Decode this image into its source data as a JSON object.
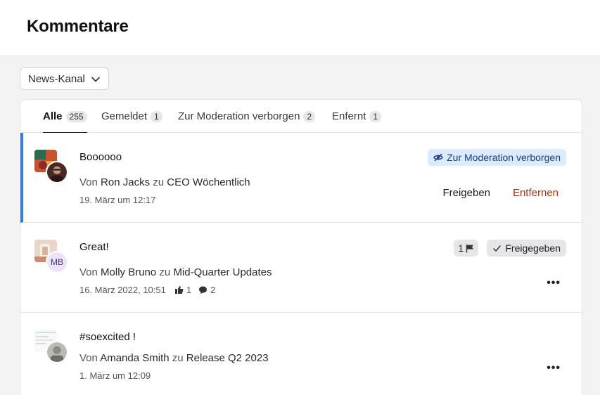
{
  "page": {
    "title": "Kommentare"
  },
  "filter": {
    "channel": "News-Kanal"
  },
  "tabs": [
    {
      "label": "Alle",
      "count": "255"
    },
    {
      "label": "Gemeldet",
      "count": "1"
    },
    {
      "label": "Zur Moderation verborgen",
      "count": "2"
    },
    {
      "label": "Enfernt",
      "count": "1"
    }
  ],
  "comments": [
    {
      "text": "Boooooo",
      "by": "Von",
      "author": "Ron Jacks",
      "to": "zu",
      "channel": "CEO Wöchentlich",
      "date": "19. März um 12:17",
      "status": "Zur Moderation verborgen",
      "approve_label": "Freigeben",
      "remove_label": "Entfernen"
    },
    {
      "text": "Great!",
      "by": "Von",
      "author": "Molly Bruno",
      "to": "zu",
      "channel": "Mid-Quarter Updates",
      "date": "16. März 2022, 10:51",
      "likes": "1",
      "replies": "2",
      "initials": "MB",
      "flags": "1",
      "status": "Freigegeben"
    },
    {
      "text": "#soexcited !",
      "by": "Von",
      "author": "Amanda Smith",
      "to": "zu",
      "channel": "Release Q2 2023",
      "date": "1. März um 12:09"
    }
  ],
  "colors": {
    "accent": "#2f7bf5",
    "remove": "#a33212",
    "hidden_badge_bg": "#dceafe",
    "initials_avatar_bg": "#ede3f7"
  },
  "icons": {
    "dropdown": "chevron-down-icon",
    "hidden": "eye-off-icon",
    "flag": "flag-icon",
    "approved": "check-icon",
    "like": "thumbs-up-icon",
    "reply": "speech-bubble-icon",
    "more": "more-horizontal-icon"
  }
}
